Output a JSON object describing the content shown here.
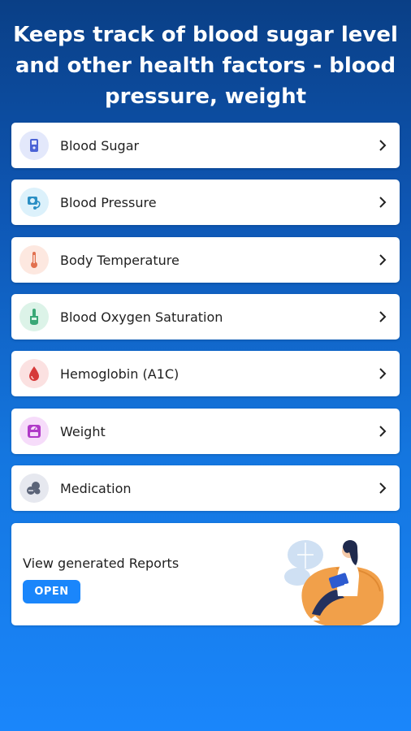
{
  "headline": "Keeps track of blood sugar level and other health factors - blood pressure, weight",
  "items": [
    {
      "label": "Blood Sugar",
      "icon": "glucometer-icon",
      "color": "#4b63d6",
      "bg": "#e3e8fb"
    },
    {
      "label": "Blood Pressure",
      "icon": "blood-pressure-monitor-icon",
      "color": "#2a8fc4",
      "bg": "#dcf1fb"
    },
    {
      "label": "Body Temperature",
      "icon": "thermometer-icon",
      "color": "#e1704f",
      "bg": "#fde8e0"
    },
    {
      "label": "Blood Oxygen Saturation",
      "icon": "finger-oximeter-icon",
      "color": "#3aa877",
      "bg": "#dcf3e8"
    },
    {
      "label": "Hemoglobin (A1C)",
      "icon": "blood-drop-icon",
      "color": "#d63a3a",
      "bg": "#fbe1e1"
    },
    {
      "label": "Weight",
      "icon": "weighing-scale-icon",
      "color": "#b03ac8",
      "bg": "#f6dcfa"
    },
    {
      "label": "Medication",
      "icon": "pills-icon",
      "color": "#5b6478",
      "bg": "#e6e8ef"
    }
  ],
  "reports": {
    "title": "View generated Reports",
    "button": "OPEN",
    "illustration": "woman-on-beanbag-with-tablet"
  }
}
